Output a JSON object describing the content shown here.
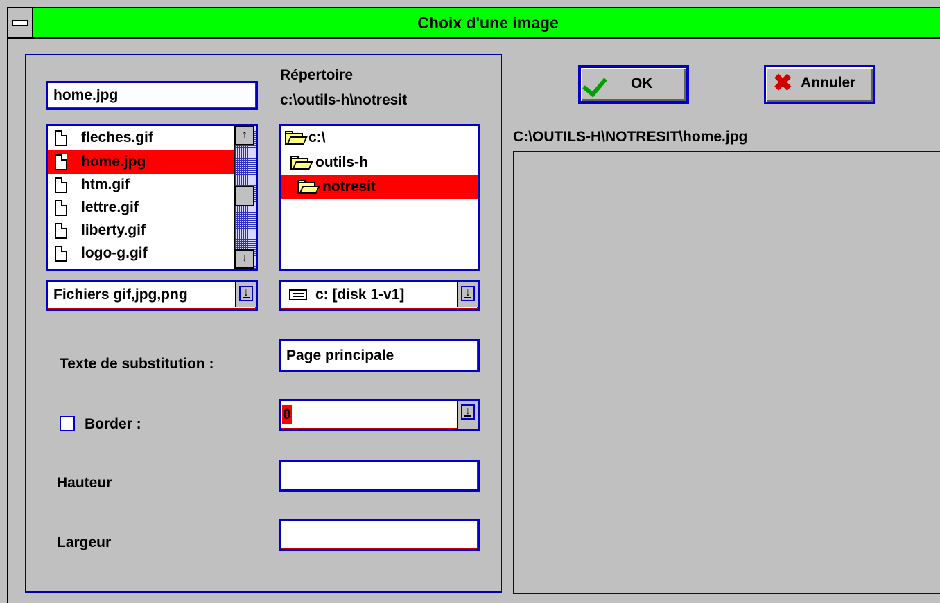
{
  "window": {
    "title": "Choix d'une image"
  },
  "filename_input": {
    "value": "home.jpg"
  },
  "directory": {
    "label": "Répertoire",
    "path": "c:\\outils-h\\notresit"
  },
  "file_list": {
    "items": [
      {
        "name": "fleches.gif",
        "selected": false
      },
      {
        "name": "home.jpg",
        "selected": true
      },
      {
        "name": "htm.gif",
        "selected": false
      },
      {
        "name": "lettre.gif",
        "selected": false
      },
      {
        "name": "liberty.gif",
        "selected": false
      },
      {
        "name": "logo-g.gif",
        "selected": false
      }
    ]
  },
  "dir_tree": {
    "items": [
      {
        "name": "c:\\",
        "level": 0,
        "icon": "open-folder-icon",
        "selected": false
      },
      {
        "name": "outils-h",
        "level": 1,
        "icon": "open-folder-icon",
        "selected": false
      },
      {
        "name": "notresit",
        "level": 2,
        "icon": "open-folder-icon",
        "selected": true
      }
    ]
  },
  "file_type_combo": {
    "value": "Fichiers gif,jpg,png"
  },
  "drive_combo": {
    "value": "c: [disk 1-v1]"
  },
  "alt_text": {
    "label": "Texte de substitution :",
    "value": "Page principale"
  },
  "border": {
    "label": "Border :",
    "checked": false,
    "value": "0"
  },
  "hauteur": {
    "label": "Hauteur",
    "value": ""
  },
  "largeur": {
    "label": "Largeur",
    "value": ""
  },
  "buttons": {
    "ok": "OK",
    "cancel": "Annuler"
  },
  "preview": {
    "path": "C:\\OUTILS-H\\NOTRESIT\\home.jpg"
  },
  "colors": {
    "titlebar": "#00ff00",
    "selection": "#ff0000",
    "frame": "#0000c8",
    "background": "#c0c0c0"
  }
}
